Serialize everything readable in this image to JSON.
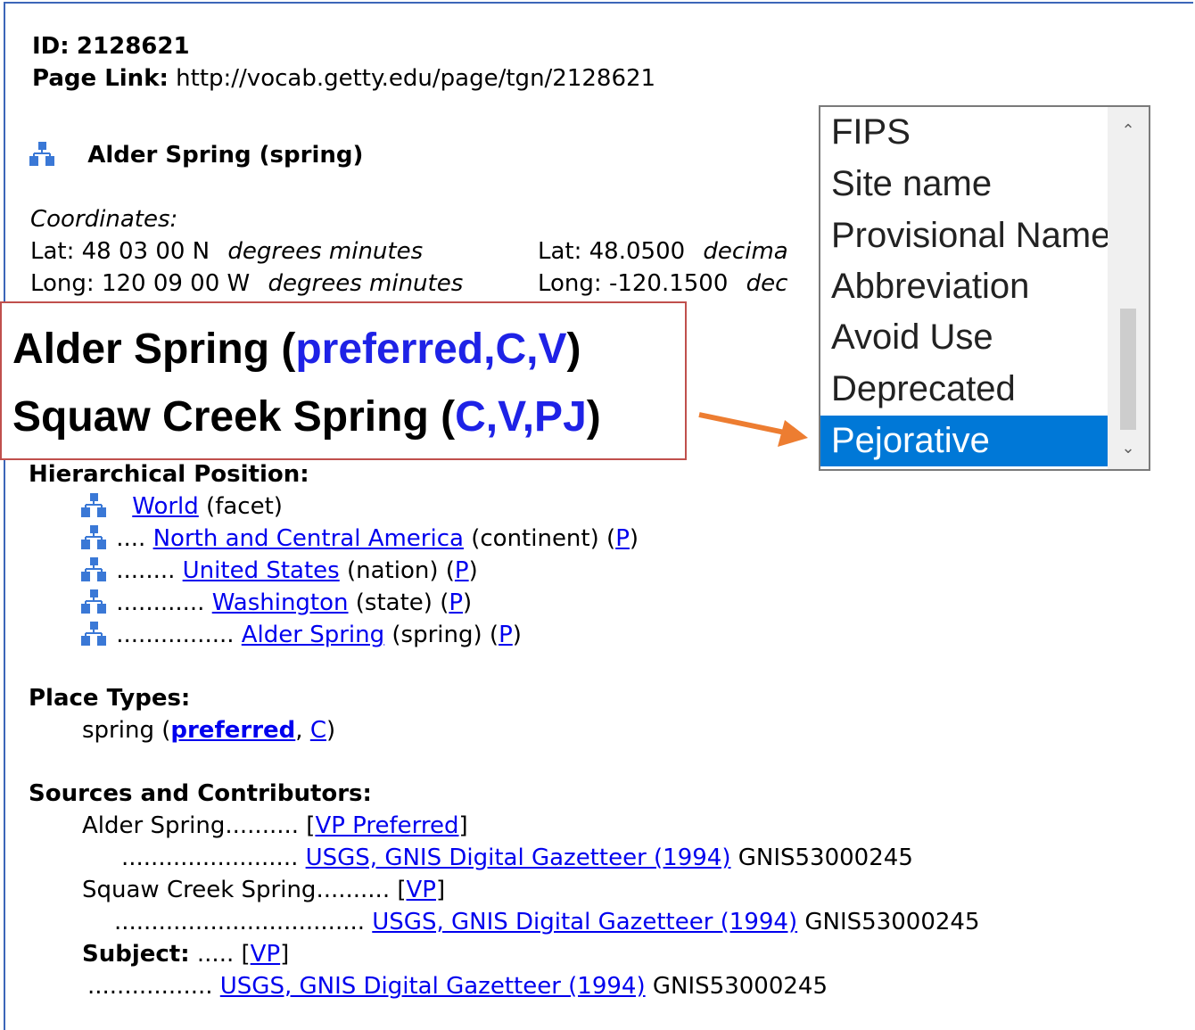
{
  "record": {
    "id_label": "ID:",
    "id_value": "2128621",
    "page_link_label": "Page Link:",
    "page_link_value": "http://vocab.getty.edu/page/tgn/2128621",
    "title": "Alder Spring (spring)"
  },
  "coordinates": {
    "heading": "Coordinates:",
    "lat_dms": "Lat: 48 03 00 N",
    "long_dms": "Long: 120 09 00 W",
    "dms_unit": "degrees minutes",
    "lat_dec": "Lat: 48.0500",
    "long_dec": "Long: -120.1500",
    "lat_dec_unit": "decima",
    "long_dec_unit": "dec"
  },
  "callout": {
    "line1_name": "Alder Spring",
    "line1_flags": "preferred,C,V",
    "line2_name": "Squaw Creek Spring",
    "line2_flags": "C,V,PJ",
    "open_paren": "(",
    "close_paren": ")"
  },
  "dropdown": {
    "items": [
      "FIPS",
      "Site name",
      "Provisional Name",
      "Abbreviation",
      "Avoid Use",
      "Deprecated",
      "Pejorative"
    ],
    "selected": "Pejorative",
    "highlight_color": "#0078d7"
  },
  "hierarchy": {
    "heading": "Hierarchical Position:",
    "rows": [
      {
        "dots": "",
        "name": "World",
        "type": "(facet)",
        "p": ""
      },
      {
        "dots": ".... ",
        "name": "North and Central America",
        "type": "(continent)",
        "p": "P"
      },
      {
        "dots": "........ ",
        "name": "United States",
        "type": "(nation)",
        "p": "P"
      },
      {
        "dots": "............ ",
        "name": "Washington",
        "type": "(state)",
        "p": "P"
      },
      {
        "dots": "................ ",
        "name": "Alder Spring",
        "type": "(spring)",
        "p": "P"
      }
    ]
  },
  "place_types": {
    "heading": "Place Types:",
    "type": "spring",
    "preferred": "preferred",
    "c": "C"
  },
  "sources": {
    "heading": "Sources and Contributors:",
    "alder_name": "Alder Spring..........",
    "alder_flag": "VP Preferred",
    "alder_dots": "........................",
    "squaw_name": "Squaw Creek Spring..........",
    "squaw_flag": "VP",
    "squaw_dots": "..................................",
    "subject_label": "Subject:",
    "subject_dots": ".....",
    "subject_flag": "VP",
    "subject_src_dots": ".................",
    "source_title": "USGS, GNIS Digital Gazetteer (1994)",
    "source_id": "GNIS53000245"
  },
  "colors": {
    "link": "#0000ee",
    "callout_border": "#c0504d",
    "callout_flag": "#1e22e6",
    "arrow": "#ed7d31",
    "icon": "#3a78d6"
  }
}
